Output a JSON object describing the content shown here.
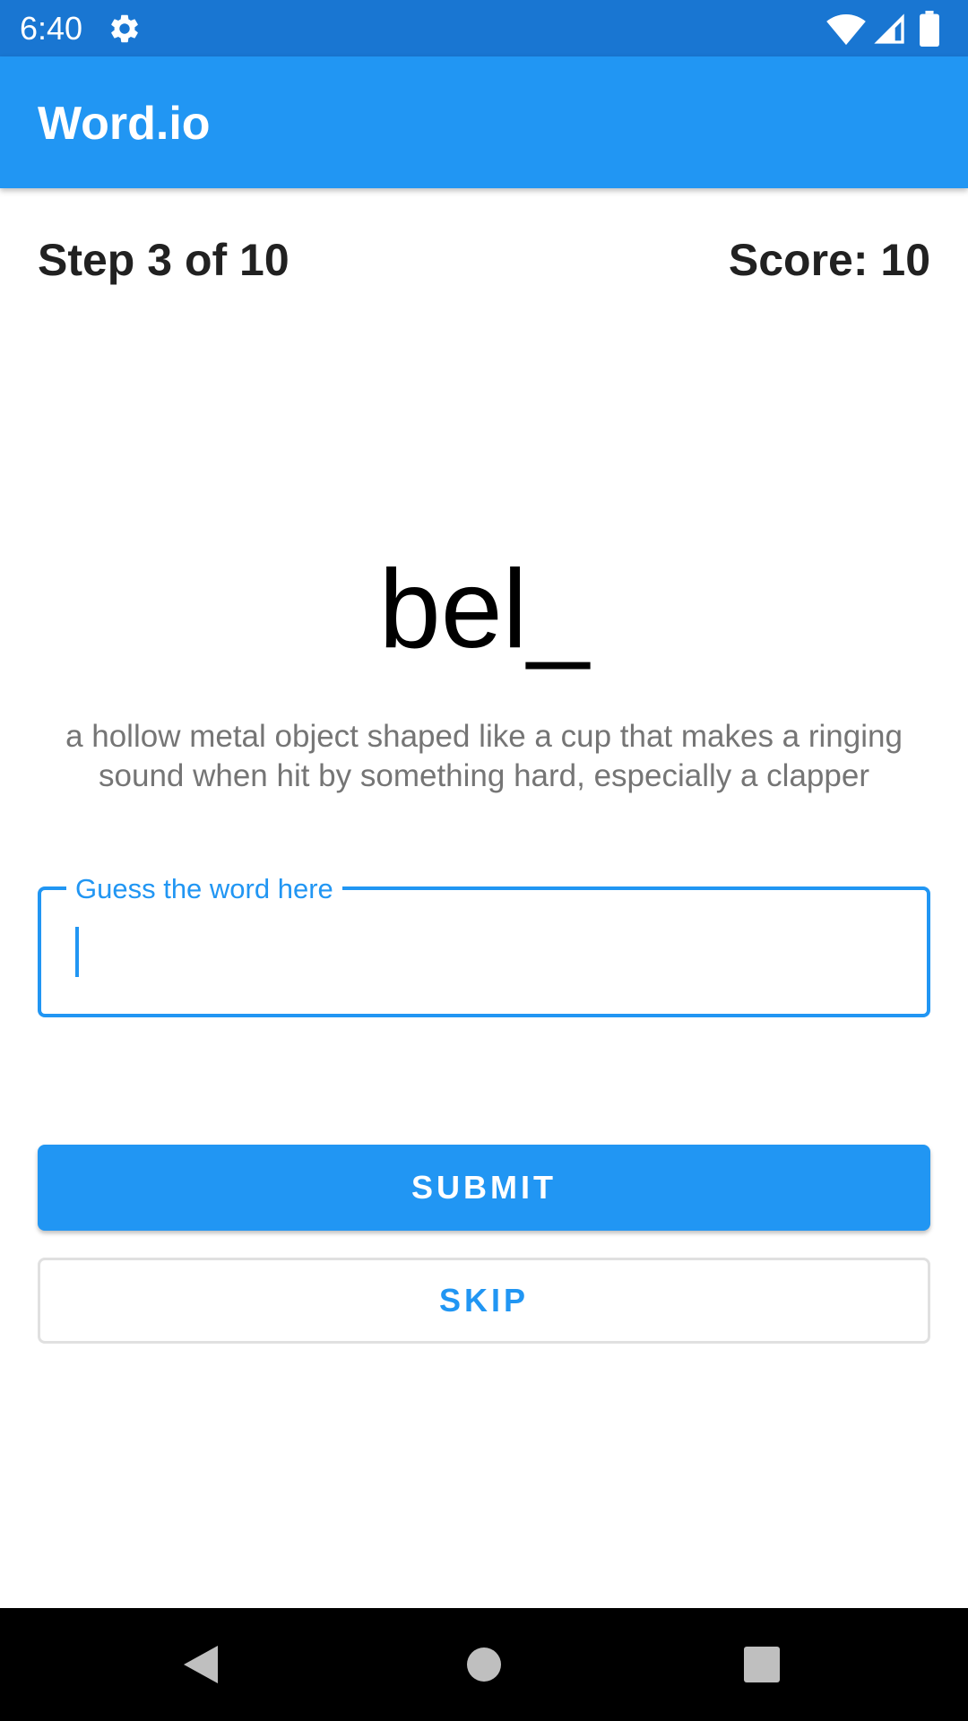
{
  "status_bar": {
    "time": "6:40",
    "icons": [
      "gear-icon",
      "wifi-icon",
      "cell-signal-icon",
      "battery-icon"
    ]
  },
  "app_bar": {
    "title": "Word.io"
  },
  "progress": {
    "step_text": "Step 3 of 10",
    "score_text": "Score: 10"
  },
  "puzzle": {
    "word_hint": "bel_",
    "definition": "a hollow metal object shaped like a cup that makes a ringing sound when hit by something hard, especially a clapper"
  },
  "guess_input": {
    "label": "Guess the word here",
    "value": ""
  },
  "actions": {
    "submit_label": "SUBMIT",
    "skip_label": "SKIP"
  },
  "nav_bar": {
    "icons": [
      "back-icon",
      "home-icon",
      "recents-icon"
    ]
  },
  "colors": {
    "status_bar": "#1976D2",
    "primary": "#2196F3",
    "text_dark": "#212121",
    "text_muted": "#757575"
  }
}
